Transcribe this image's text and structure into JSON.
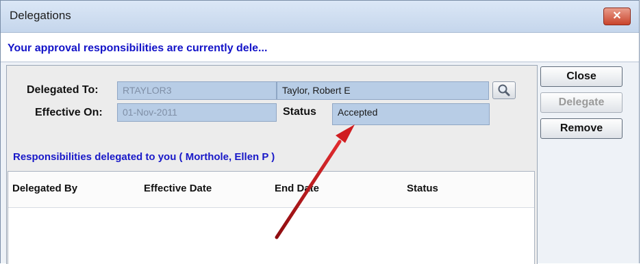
{
  "window": {
    "title": "Delegations",
    "close_glyph": "✕"
  },
  "banner": {
    "text": "Your approval responsibilities are currently dele..."
  },
  "form": {
    "delegated_to_label": "Delegated To:",
    "delegated_to_id": "RTAYLOR3",
    "delegated_to_name": "Taylor, Robert E",
    "effective_on_label": "Effective On:",
    "effective_on_value": "01-Nov-2011",
    "status_label": "Status",
    "status_value": "Accepted"
  },
  "buttons": {
    "close": "Close",
    "delegate": "Delegate",
    "remove": "Remove"
  },
  "section": {
    "title": "Responsibilities delegated to you ( Morthole, Ellen P )"
  },
  "table": {
    "columns": [
      "Delegated By",
      "Effective Date",
      "End Date",
      "Status"
    ],
    "rows": []
  },
  "colors": {
    "accent_text": "#1818c8",
    "field_bg": "#b8cde6",
    "annotation_arrow": "#c0161b"
  },
  "icons": {
    "lookup": "magnifier-icon",
    "close": "close-icon"
  }
}
